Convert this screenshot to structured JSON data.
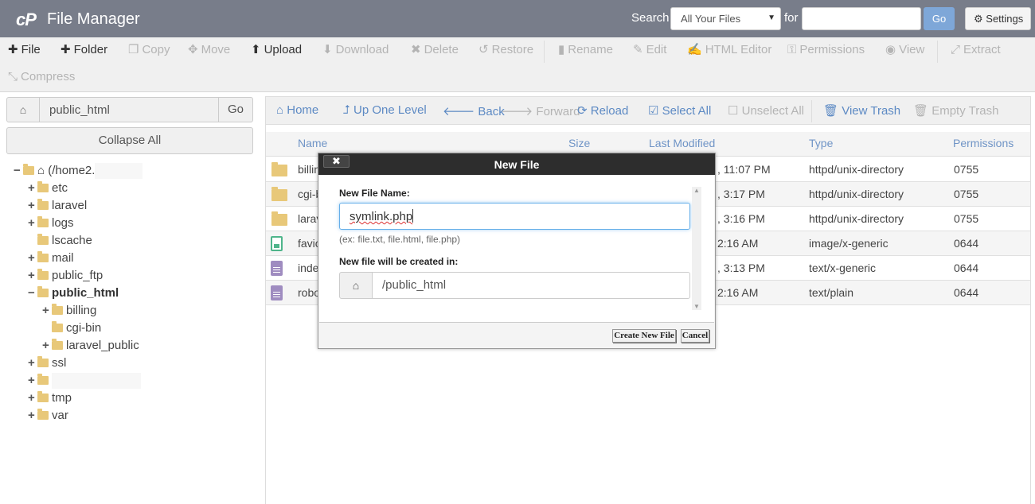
{
  "header": {
    "app_title": "File Manager",
    "logo_text": "cP",
    "search_label": "Search",
    "search_scope": "All Your Files",
    "for_label": "for",
    "search_value": "",
    "go_label": "Go",
    "settings_label": "Settings"
  },
  "toolbar": {
    "items": [
      {
        "label": "File",
        "icon": "plus-icon",
        "enabled": true
      },
      {
        "label": "Folder",
        "icon": "plus-icon",
        "enabled": true
      },
      {
        "label": "Copy",
        "icon": "copy-icon",
        "enabled": false
      },
      {
        "label": "Move",
        "icon": "move-icon",
        "enabled": false
      },
      {
        "label": "Upload",
        "icon": "upload-icon",
        "enabled": true
      },
      {
        "label": "Download",
        "icon": "download-icon",
        "enabled": false
      },
      {
        "label": "Delete",
        "icon": "close-icon",
        "enabled": false
      },
      {
        "label": "Restore",
        "icon": "undo-icon",
        "enabled": false
      },
      {
        "label": "Rename",
        "icon": "file-icon",
        "enabled": false
      },
      {
        "label": "Edit",
        "icon": "pencil-icon",
        "enabled": false
      },
      {
        "label": "HTML Editor",
        "icon": "edit-icon",
        "enabled": false
      },
      {
        "label": "Permissions",
        "icon": "key-icon",
        "enabled": false
      },
      {
        "label": "View",
        "icon": "eye-icon",
        "enabled": false
      },
      {
        "label": "Extract",
        "icon": "expand-icon",
        "enabled": false
      },
      {
        "label": "Compress",
        "icon": "compress-icon",
        "enabled": false
      }
    ]
  },
  "sidebar": {
    "path_value": "public_html",
    "go_label": "Go",
    "collapse_label": "Collapse All",
    "tree": [
      {
        "label": "(/home2.",
        "toggle": "−",
        "level": 0
      },
      {
        "label": "etc",
        "toggle": "+",
        "level": 1
      },
      {
        "label": "laravel",
        "toggle": "+",
        "level": 1
      },
      {
        "label": "logs",
        "toggle": "+",
        "level": 1
      },
      {
        "label": "lscache",
        "toggle": "",
        "level": 1
      },
      {
        "label": "mail",
        "toggle": "+",
        "level": 1
      },
      {
        "label": "public_ftp",
        "toggle": "+",
        "level": 1
      },
      {
        "label": "public_html",
        "toggle": "−",
        "level": 1
      },
      {
        "label": "billing",
        "toggle": "+",
        "level": 2
      },
      {
        "label": "cgi-bin",
        "toggle": "",
        "level": 2
      },
      {
        "label": "laravel_public",
        "toggle": "+",
        "level": 2
      },
      {
        "label": "ssl",
        "toggle": "+",
        "level": 1
      },
      {
        "label": "",
        "toggle": "+",
        "level": 1
      },
      {
        "label": "tmp",
        "toggle": "+",
        "level": 1
      },
      {
        "label": "var",
        "toggle": "+",
        "level": 1
      }
    ]
  },
  "nav": {
    "items": [
      {
        "label": "Home",
        "enabled": true
      },
      {
        "label": "Up One Level",
        "enabled": true
      },
      {
        "label": "Back",
        "enabled": true
      },
      {
        "label": "Forward",
        "enabled": false
      },
      {
        "label": "Reload",
        "enabled": true
      },
      {
        "label": "Select All",
        "enabled": true
      },
      {
        "label": "Unselect All",
        "enabled": false
      },
      {
        "label": "View Trash",
        "enabled": true
      },
      {
        "label": "Empty Trash",
        "enabled": false
      }
    ]
  },
  "table": {
    "headers": {
      "name": "Name",
      "size": "Size",
      "modified": "Last Modified",
      "type": "Type",
      "permissions": "Permissions"
    },
    "rows": [
      {
        "name": "billin",
        "modified": ", 11:07 PM",
        "type": "httpd/unix-directory",
        "perms": "0755",
        "icon": "folder-icon"
      },
      {
        "name": "cgi-b",
        "modified": ", 3:17 PM",
        "type": "httpd/unix-directory",
        "perms": "0755",
        "icon": "folder-icon"
      },
      {
        "name": "larav",
        "modified": ", 3:16 PM",
        "type": "httpd/unix-directory",
        "perms": "0755",
        "icon": "folder-icon"
      },
      {
        "name": "favic",
        "modified": "2:16 AM",
        "type": "image/x-generic",
        "perms": "0644",
        "icon": "image-file-icon"
      },
      {
        "name": "inde",
        "modified": ", 3:13 PM",
        "type": "text/x-generic",
        "perms": "0644",
        "icon": "text-file-icon"
      },
      {
        "name": "robo",
        "modified": "2:16 AM",
        "type": "text/plain",
        "perms": "0644",
        "icon": "text-file-icon"
      }
    ]
  },
  "modal": {
    "title": "New File",
    "close_label": "✖",
    "name_label": "New File Name:",
    "name_value": "symlink.php",
    "hint": "(ex: file.txt, file.html, file.php)",
    "location_label": "New file will be created in:",
    "location_value": "/public_html",
    "create_label": "Create New File",
    "cancel_label": "Cancel"
  },
  "colors": {
    "header_bg": "#787d8a",
    "link_blue": "#5d8ac4",
    "disabled": "#b4b4b4",
    "folder": "#e8c879"
  }
}
